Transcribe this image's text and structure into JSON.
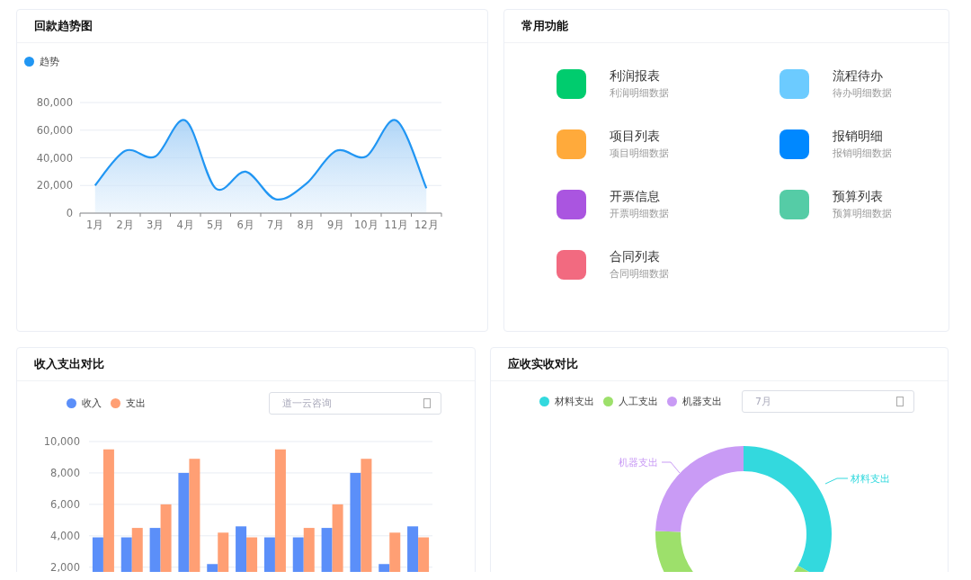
{
  "trend_panel": {
    "title": "回款趋势图",
    "chart_data": {
      "type": "area",
      "categories": [
        "1月",
        "2月",
        "3月",
        "4月",
        "5月",
        "6月",
        "7月",
        "8月",
        "9月",
        "10月",
        "11月",
        "12月"
      ],
      "series": [
        {
          "name": "趋势",
          "color": "#2196f3",
          "values": [
            20000,
            45000,
            41000,
            67000,
            18000,
            30000,
            10000,
            21000,
            45000,
            41000,
            67000,
            18000
          ]
        }
      ],
      "ylim": [
        0,
        80000
      ],
      "grid": true,
      "yticks": [
        {
          "value": 0,
          "label": "0"
        },
        {
          "value": 20000,
          "label": "20,000"
        },
        {
          "value": 40000,
          "label": "40,000"
        },
        {
          "value": 60000,
          "label": "60,000"
        },
        {
          "value": 80000,
          "label": "80,000"
        }
      ]
    }
  },
  "functions_panel": {
    "title": "常用功能",
    "items": [
      {
        "title": "利润报表",
        "subtitle": "利润明细数据",
        "color": "#00cc6e"
      },
      {
        "title": "流程待办",
        "subtitle": "待办明细数据",
        "color": "#6ccbff"
      },
      {
        "title": "项目列表",
        "subtitle": "项目明细数据",
        "color": "#ffaa3b"
      },
      {
        "title": "报销明细",
        "subtitle": "报销明细数据",
        "color": "#0088ff"
      },
      {
        "title": "开票信息",
        "subtitle": "开票明细数据",
        "color": "#aa55e0"
      },
      {
        "title": "预算列表",
        "subtitle": "预算明细数据",
        "color": "#55cca6"
      },
      {
        "title": "合同列表",
        "subtitle": "合同明细数据",
        "color": "#f26a80"
      }
    ]
  },
  "income_panel": {
    "title": "收入支出对比",
    "search": {
      "placeholder": "道一云咨询"
    },
    "chart_data": {
      "type": "bar",
      "series": [
        {
          "name": "收入",
          "color": "#5b8ff9",
          "values": [
            3900,
            3900,
            4500,
            8000,
            2200,
            4600,
            3900,
            3900,
            4500,
            8000,
            2200,
            4600
          ]
        },
        {
          "name": "支出",
          "color": "#ff9f74",
          "values": [
            9500,
            4500,
            6000,
            8900,
            4200,
            3900,
            9500,
            4500,
            6000,
            8900,
            4200,
            3900
          ]
        }
      ],
      "ylim": [
        1700,
        10000
      ],
      "grid": true,
      "yticks": [
        {
          "value": 2000,
          "label": "2,000"
        },
        {
          "value": 4000,
          "label": "4,000"
        },
        {
          "value": 6000,
          "label": "6,000"
        },
        {
          "value": 8000,
          "label": "8,000"
        },
        {
          "value": 10000,
          "label": "10,000"
        }
      ]
    }
  },
  "receivable_panel": {
    "title": "应收实收对比",
    "month_field": {
      "placeholder": "7月"
    },
    "legend": [
      {
        "label": "材料支出",
        "color": "#33d9de"
      },
      {
        "label": "人工支出",
        "color": "#9de06b"
      },
      {
        "label": "机器支出",
        "color": "#c99bf5"
      }
    ],
    "donut_labels": [
      {
        "label": "机器支出",
        "color": "#c99bf5"
      },
      {
        "label": "材料支出",
        "color": "#33d9de"
      }
    ]
  }
}
